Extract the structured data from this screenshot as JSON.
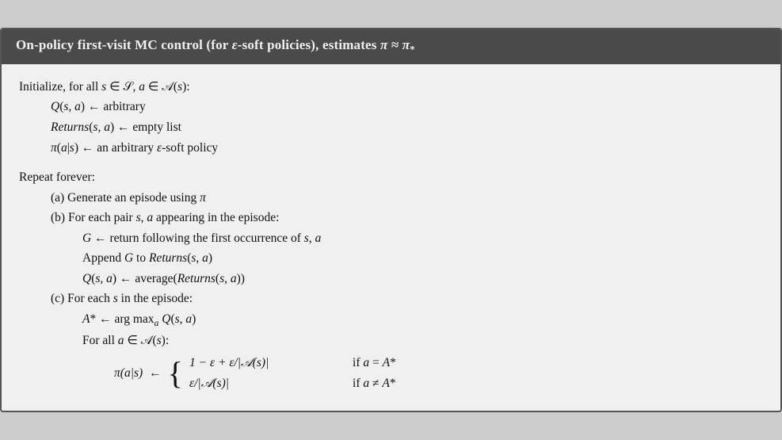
{
  "header": {
    "text": "On-policy first-visit MC control (for ε-soft policies), estimates π ≈ π*"
  },
  "body": {
    "initialize_line": "Initialize, for all s ∈ 𝒮, a ∈ 𝒜(s):",
    "q_init": "Q(s, a) ← arbitrary",
    "returns_init": "Returns(s, a) ← empty list",
    "pi_init": "π(a|s) ← an arbitrary ε-soft policy",
    "repeat_line": "Repeat forever:",
    "step_a": "(a) Generate an episode using π",
    "step_b": "(b) For each pair s, a appearing in the episode:",
    "g_def": "G ← return following the first occurrence of s, a",
    "append_g": "Append G to Returns(s, a)",
    "q_update": "Q(s, a) ← average(Returns(s, a))",
    "step_c": "(c) For each s in the episode:",
    "a_star": "A* ← arg max_a Q(s, a)",
    "for_all_a": "For all a ∈ 𝒜(s):",
    "pi_lhs": "π(a|s) ←",
    "case1_expr": "1 − ε + ε/|𝒜(s)|",
    "case1_cond": "if a = A*",
    "case2_expr": "ε/|𝒜(s)|",
    "case2_cond": "if a ≠ A*"
  }
}
